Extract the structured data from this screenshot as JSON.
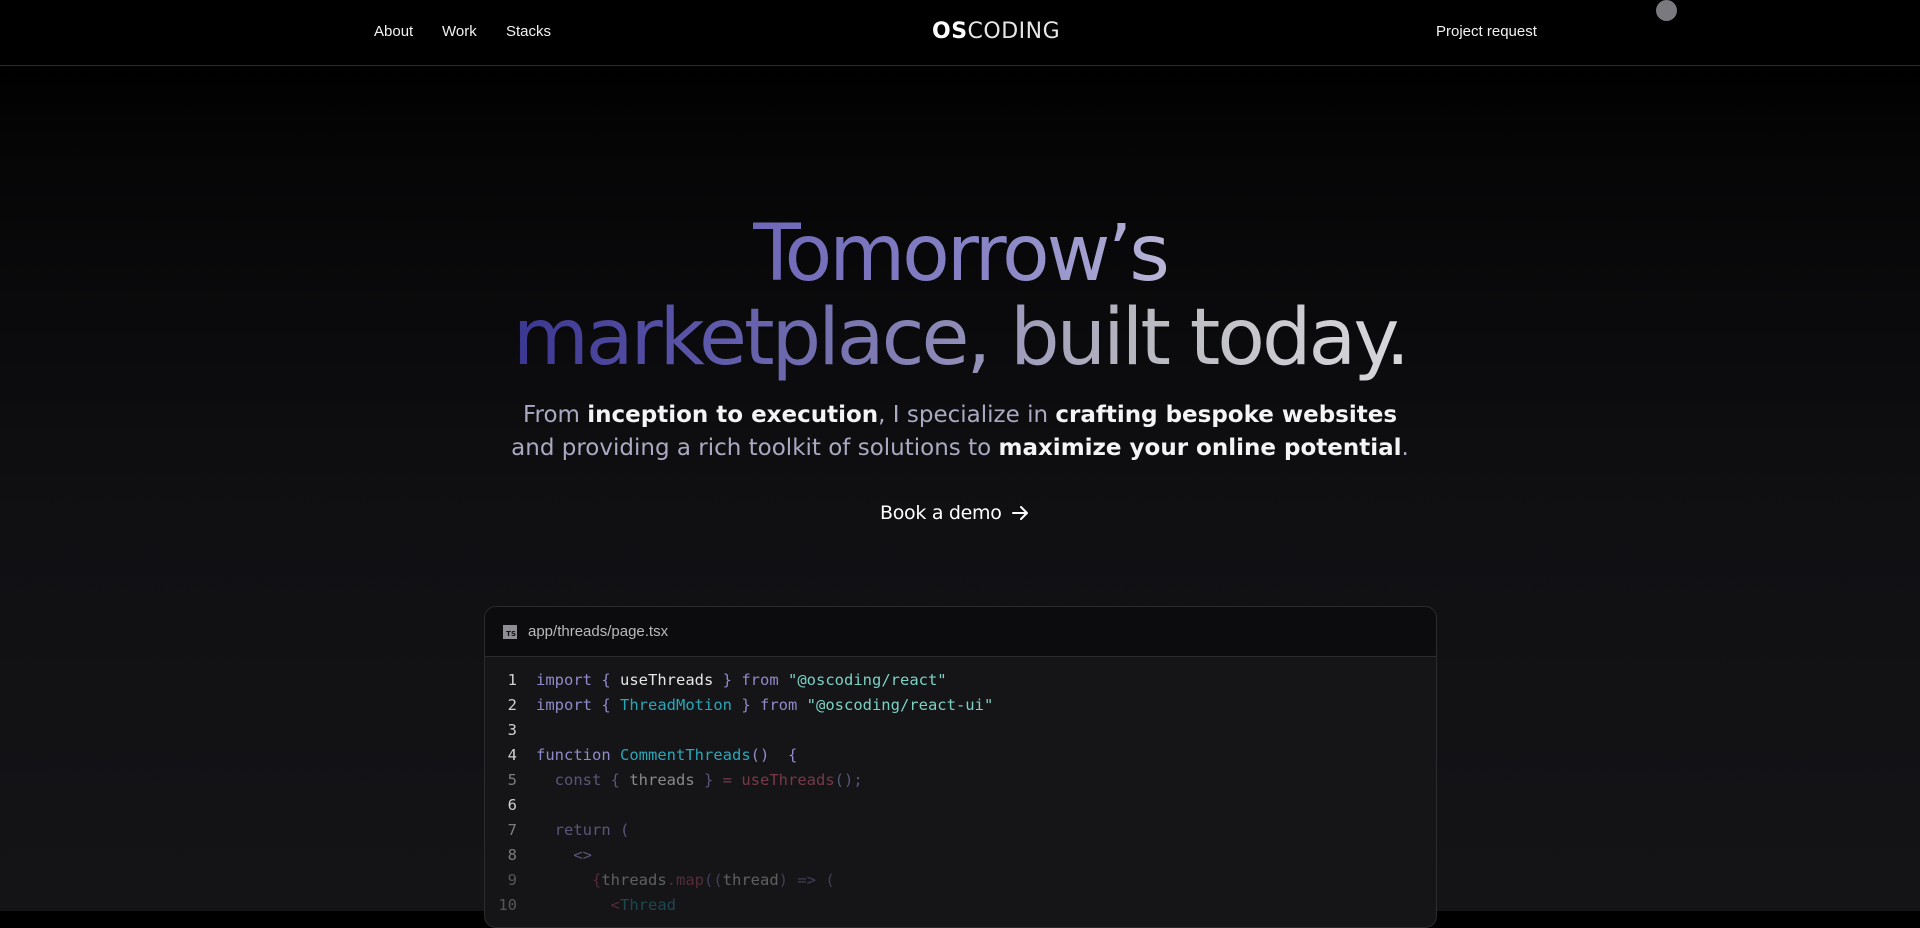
{
  "nav": {
    "links": [
      {
        "label": "About"
      },
      {
        "label": "Work"
      },
      {
        "label": "Stacks"
      }
    ],
    "logo_bold": "OS",
    "logo_thin": "CODING",
    "request_label": "Project request"
  },
  "hero": {
    "title_line1": "Tomorrow’s",
    "title_line2": "marketplace, built today.",
    "subtitle_parts": [
      "From ",
      "inception to execution",
      ", I specialize in ",
      "crafting bespoke websites",
      "and providing a rich toolkit of solutions to ",
      "maximize your online potential",
      "."
    ],
    "cta_label": "Book a demo",
    "cta_icon": "arrow-right-icon"
  },
  "code_window": {
    "file_icon": "typescript-file-icon",
    "file_icon_text": "TS",
    "file_path": "app/threads/page.tsx",
    "lines": [
      {
        "num": "1",
        "tokens": [
          "import",
          " { ",
          "useThreads",
          " } ",
          "from",
          " ",
          "\"@oscoding/react\""
        ]
      },
      {
        "num": "2",
        "tokens": [
          "import",
          " { ",
          "ThreadMotion",
          " } ",
          "from",
          " ",
          "\"@oscoding/react-ui\""
        ]
      },
      {
        "num": "3",
        "tokens": []
      },
      {
        "num": "4",
        "tokens": [
          "function",
          " ",
          "CommentThreads",
          "()",
          "  {"
        ]
      },
      {
        "num": "5",
        "tokens": [
          "  const",
          " { ",
          "threads",
          " } ",
          "= ",
          "useThreads",
          "();"
        ]
      },
      {
        "num": "6",
        "tokens": []
      },
      {
        "num": "7",
        "tokens": [
          "  return",
          " ("
        ]
      },
      {
        "num": "8",
        "tokens": [
          "    <>"
        ]
      },
      {
        "num": "9",
        "tokens": [
          "      {",
          "threads",
          ".map",
          "((",
          "thread",
          ") => ("
        ]
      },
      {
        "num": "10",
        "tokens": [
          "        <",
          "Thread"
        ]
      }
    ]
  },
  "colors": {
    "accent_purple": "#8f8ac9",
    "accent_teal": "#2aa6b8",
    "string_green": "#7ad1c4",
    "call_red": "#c95570"
  }
}
